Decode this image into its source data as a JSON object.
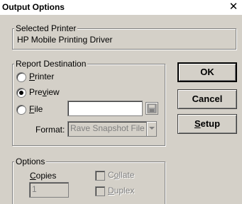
{
  "window": {
    "title": "Output Options",
    "close_glyph": "✕"
  },
  "selected_printer": {
    "legend": "Selected Printer",
    "name": "HP Mobile Printing Driver"
  },
  "report_destination": {
    "legend": "Report Destination",
    "options": [
      {
        "label_pre": "",
        "label_u": "P",
        "label_post": "rinter",
        "checked": false
      },
      {
        "label_pre": "Pre",
        "label_u": "v",
        "label_post": "iew",
        "checked": true
      },
      {
        "label_pre": "",
        "label_u": "F",
        "label_post": "ile",
        "checked": false
      }
    ],
    "file_value": "",
    "format_label": "Format:",
    "format_value": "Rave Snapshot File"
  },
  "buttons": {
    "ok": "OK",
    "cancel": "Cancel",
    "setup_u": "S",
    "setup_rest": "etup"
  },
  "options": {
    "legend": "Options",
    "copies_u": "C",
    "copies_rest": "opies",
    "copies_value": "1",
    "collate_pre": "C",
    "collate_u": "o",
    "collate_rest": "llate",
    "duplex_u": "D",
    "duplex_rest": "uplex"
  }
}
